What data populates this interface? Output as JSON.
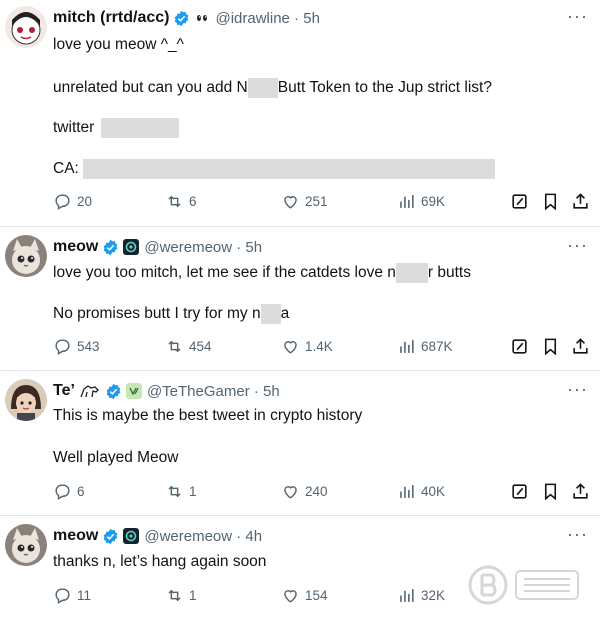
{
  "tweets": [
    {
      "name": "mitch (rrtd/acc)",
      "handle": "@idrawline · 5h",
      "lines": {
        "l1": "love you meow ^_^",
        "l2a": "unrelated but can you add N",
        "l2b": "Butt Token to the Jup strict list?",
        "l3": "twitter",
        "l4": "CA:"
      },
      "stats": {
        "replies": "20",
        "reposts": "6",
        "likes": "251",
        "views": "69K"
      }
    },
    {
      "name": "meow",
      "handle": "@weremeow · 5h",
      "lines": {
        "l1a": "love you too mitch, let me see if the catdets love n",
        "l1b": "r butts",
        "l2a": "No promises butt I try for my n",
        "l2b": "a"
      },
      "stats": {
        "replies": "543",
        "reposts": "454",
        "likes": "1.4K",
        "views": "687K"
      }
    },
    {
      "name": "Te’",
      "handle": "@TeTheGamer · 5h",
      "lines": {
        "l1": "This is maybe the best tweet in crypto history",
        "l2": "Well played Meow"
      },
      "stats": {
        "replies": "6",
        "reposts": "1",
        "likes": "240",
        "views": "40K"
      }
    },
    {
      "name": "meow",
      "handle": "@weremeow · 4h",
      "lines": {
        "l1": "thanks n, let’s hang again soon"
      },
      "stats": {
        "replies": "11",
        "reposts": "1",
        "likes": "154",
        "views": "32K"
      }
    }
  ],
  "more_glyph": "···",
  "colors": {
    "verified": "#1d9bf0",
    "text": "#0f1419",
    "muted": "#536471"
  }
}
